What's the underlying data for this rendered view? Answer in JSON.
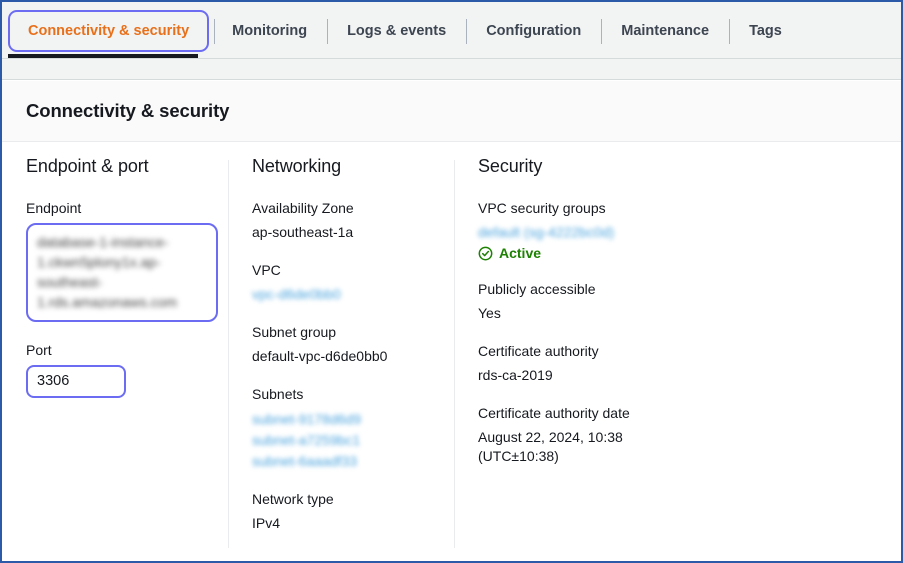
{
  "tabs": [
    {
      "label": "Connectivity & security",
      "active": true
    },
    {
      "label": "Monitoring",
      "active": false
    },
    {
      "label": "Logs & events",
      "active": false
    },
    {
      "label": "Configuration",
      "active": false
    },
    {
      "label": "Maintenance",
      "active": false
    },
    {
      "label": "Tags",
      "active": false
    }
  ],
  "card": {
    "title": "Connectivity & security"
  },
  "endpoint_port": {
    "heading": "Endpoint & port",
    "endpoint_label": "Endpoint",
    "endpoint_value": "database-1-instance-1.ckwn5plony1x.ap-southeast-1.rds.amazonaws.com",
    "port_label": "Port",
    "port_value": "3306"
  },
  "networking": {
    "heading": "Networking",
    "az_label": "Availability Zone",
    "az_value": "ap-southeast-1a",
    "vpc_label": "VPC",
    "vpc_value": "vpc-d6de0bb0",
    "subnet_group_label": "Subnet group",
    "subnet_group_value": "default-vpc-d6de0bb0",
    "subnets_label": "Subnets",
    "subnets": [
      "subnet-9178d6d9",
      "subnet-a7259bc1",
      "subnet-6aaadf33"
    ],
    "network_type_label": "Network type",
    "network_type_value": "IPv4"
  },
  "security": {
    "heading": "Security",
    "sg_label": "VPC security groups",
    "sg_value": "default (sg-4222bc0d)",
    "sg_status": "Active",
    "sg_status_icon": "check-circle-icon",
    "public_label": "Publicly accessible",
    "public_value": "Yes",
    "ca_label": "Certificate authority",
    "ca_value": "rds-ca-2019",
    "ca_date_label": "Certificate authority date",
    "ca_date_value": "August 22, 2024, 10:38 (UTC±10:38)"
  },
  "colors": {
    "active_tab_text": "#e8701a",
    "focus_ring": "#6c6cf2",
    "link": "#0073bb",
    "status_green": "#1d8102",
    "page_border": "#2c5aa8"
  }
}
